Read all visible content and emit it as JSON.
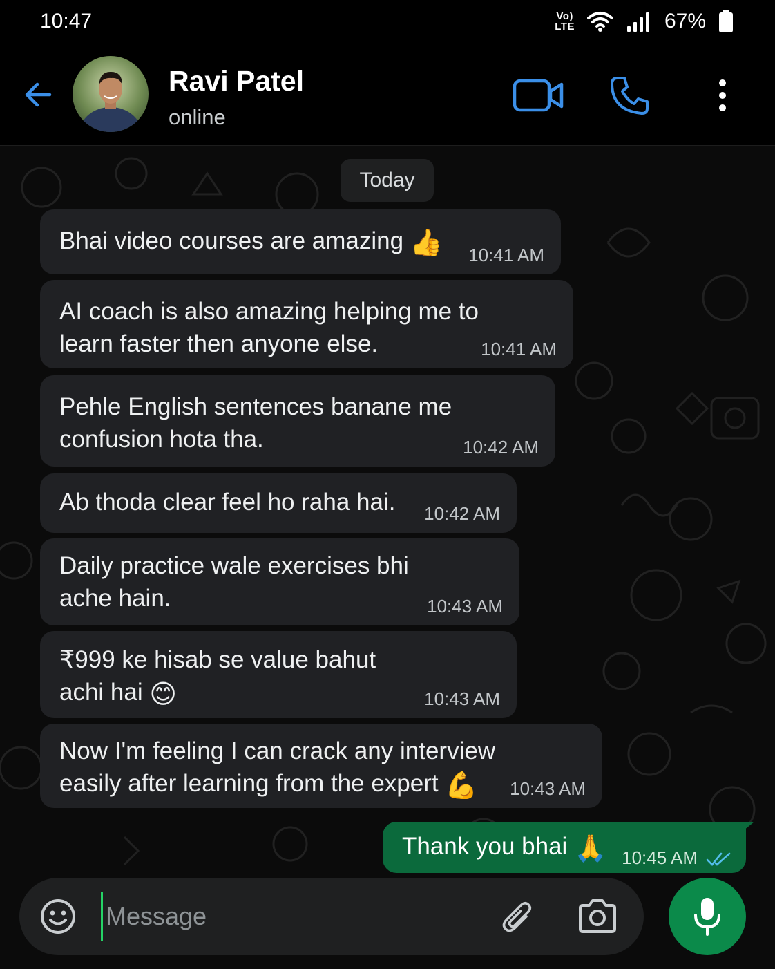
{
  "status_bar": {
    "time": "10:47",
    "volte_top": "Vo)",
    "volte_bottom": "LTE",
    "battery_percent": "67%"
  },
  "header": {
    "contact_name": "Ravi Patel",
    "contact_status": "online"
  },
  "chat": {
    "date_chip": "Today",
    "messages": [
      {
        "text": "Bhai video courses are amazing",
        "emoji": "👍",
        "time": "10:41 AM"
      },
      {
        "line1": "AI coach is also amazing helping me to",
        "line2": "learn faster then anyone else.",
        "time": "10:41 AM"
      },
      {
        "line1": "Pehle English sentences banane me",
        "line2": "confusion hota tha.",
        "time": "10:42 AM"
      },
      {
        "text": "Ab thoda clear feel ho raha hai.",
        "time": "10:42 AM"
      },
      {
        "line1": "Daily practice wale exercises bhi",
        "line2": "ache hain.",
        "time": "10:43 AM"
      },
      {
        "line1": "₹999 ke hisab se value bahut",
        "line2": "achi hai",
        "emoji": "😊",
        "time": "10:43 AM"
      },
      {
        "line1": "Now I'm feeling I can crack any interview",
        "line2": "easily after learning from the expert",
        "emoji": "💪",
        "time": "10:43 AM"
      }
    ],
    "outgoing": {
      "text": "Thank you bhai",
      "emoji": "🙏",
      "time": "10:45 AM",
      "status": "read"
    }
  },
  "composer": {
    "placeholder": "Message"
  },
  "colors": {
    "accent_blue": "#3b8fe8",
    "outgoing_bubble": "#0b6a3c",
    "incoming_bubble": "#202124",
    "mic_button": "#0b8a4a"
  },
  "icons": [
    "back-arrow-icon",
    "video-call-icon",
    "phone-icon",
    "more-vert-icon",
    "emoji-icon",
    "attach-icon",
    "camera-icon",
    "mic-icon",
    "double-check-icon"
  ]
}
